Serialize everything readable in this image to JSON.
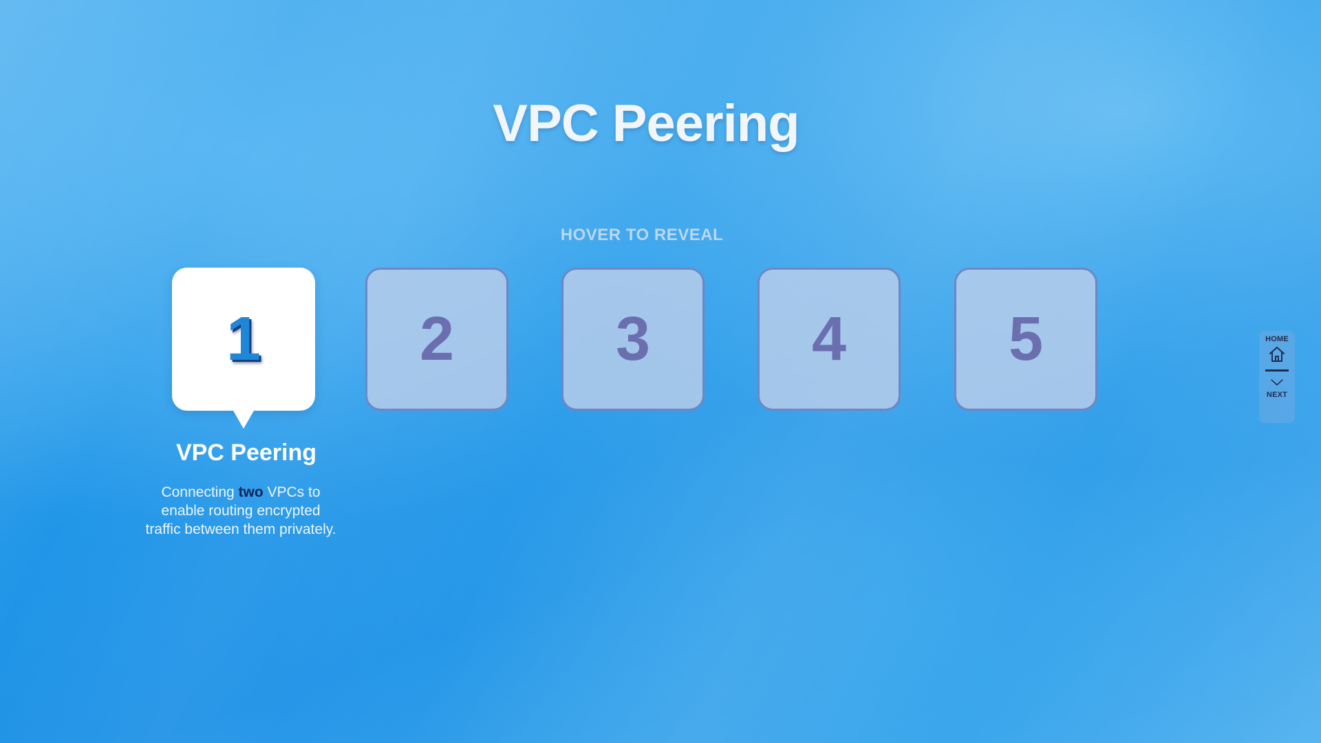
{
  "page": {
    "title": "VPC Peering",
    "hint": "HOVER TO REVEAL"
  },
  "cards": [
    {
      "label": "1",
      "active": true
    },
    {
      "label": "2",
      "active": false
    },
    {
      "label": "3",
      "active": false
    },
    {
      "label": "4",
      "active": false
    },
    {
      "label": "5",
      "active": false
    }
  ],
  "detail": {
    "title": "VPC Peering",
    "text_before": "Connecting ",
    "text_emph": "two",
    "text_after": " VPCs to enable routing encrypted traffic between them privately."
  },
  "nav": {
    "home_label": "HOME",
    "home_icon": "home-icon",
    "next_label": "NEXT",
    "next_icon": "chevron-down-icon"
  },
  "colors": {
    "active_number": "#1f86d8",
    "inactive_number": "#6b6faf",
    "emphasis": "#12245c"
  }
}
